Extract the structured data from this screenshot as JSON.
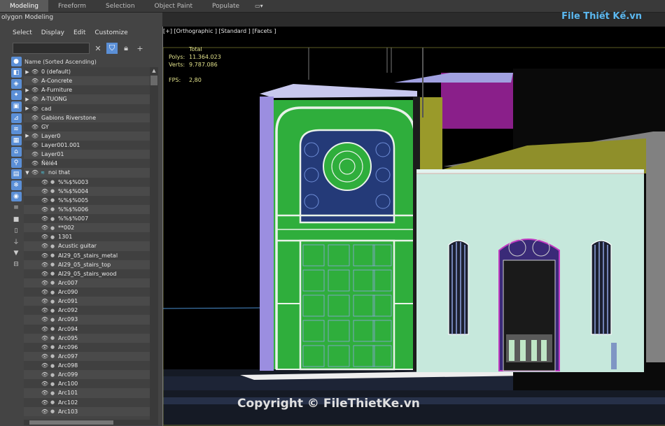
{
  "ribbon": {
    "tabs": [
      "Modeling",
      "Freeform",
      "Selection",
      "Object Paint",
      "Populate"
    ],
    "active": "Modeling",
    "subtab": "olygon Modeling"
  },
  "explorer": {
    "menu": [
      "Select",
      "Display",
      "Edit",
      "Customize"
    ],
    "search_placeholder": "",
    "column_header": "Name (Sorted Ascending)",
    "rows": [
      {
        "label": "0 (default)",
        "level": 0,
        "expander": true
      },
      {
        "label": "A-Concrete",
        "level": 0,
        "expander": false
      },
      {
        "label": "A-Furniture",
        "level": 0,
        "expander": true
      },
      {
        "label": "A-TUONG",
        "level": 0,
        "expander": true
      },
      {
        "label": "cad",
        "level": 0,
        "expander": true
      },
      {
        "label": "Gabions Riverstone",
        "level": 0,
        "expander": false
      },
      {
        "label": "GY",
        "level": 0,
        "expander": false
      },
      {
        "label": "Layer0",
        "level": 0,
        "expander": true
      },
      {
        "label": "Layer001.001",
        "level": 0,
        "expander": false
      },
      {
        "label": "Layer01",
        "level": 0,
        "expander": false
      },
      {
        "label": "Ñèlé4",
        "level": 0,
        "expander": false
      },
      {
        "label": "noi that",
        "level": 0,
        "expander": "open"
      },
      {
        "label": "%%$%003",
        "level": 1
      },
      {
        "label": "%%$%004",
        "level": 1
      },
      {
        "label": "%%$%005",
        "level": 1
      },
      {
        "label": "%%$%006",
        "level": 1
      },
      {
        "label": "%%$%007",
        "level": 1
      },
      {
        "label": "**002",
        "level": 1
      },
      {
        "label": "1301",
        "level": 1
      },
      {
        "label": "Acustic guitar",
        "level": 1
      },
      {
        "label": "AI29_05_stairs_metal",
        "level": 1
      },
      {
        "label": "AI29_05_stairs_top",
        "level": 1
      },
      {
        "label": "AI29_05_stairs_wood",
        "level": 1
      },
      {
        "label": "Arc007",
        "level": 1
      },
      {
        "label": "Arc090",
        "level": 1
      },
      {
        "label": "Arc091",
        "level": 1
      },
      {
        "label": "Arc092",
        "level": 1
      },
      {
        "label": "Arc093",
        "level": 1
      },
      {
        "label": "Arc094",
        "level": 1
      },
      {
        "label": "Arc095",
        "level": 1
      },
      {
        "label": "Arc096",
        "level": 1
      },
      {
        "label": "Arc097",
        "level": 1
      },
      {
        "label": "Arc098",
        "level": 1
      },
      {
        "label": "Arc099",
        "level": 1
      },
      {
        "label": "Arc100",
        "level": 1
      },
      {
        "label": "Arc101",
        "level": 1
      },
      {
        "label": "Arc102",
        "level": 1
      },
      {
        "label": "Arc103",
        "level": 1
      }
    ]
  },
  "viewport": {
    "label": "[+] [Orthographic ] [Standard ] [Facets ]",
    "stats": {
      "total_label": "Total",
      "polys_label": "Polys:",
      "polys_value": "11.364.023",
      "verts_label": "Verts:",
      "verts_value": "9.787.086",
      "fps_label": "FPS:",
      "fps_value": "2,80"
    }
  },
  "branding": {
    "logo": "File Thiết Kế.vn",
    "watermark": "Copyright © FileThietKe.vn"
  },
  "colors": {
    "accent": "#5b8fd6",
    "facade_green": "#2fae3c",
    "wall_mint": "#c6e8dc",
    "roof_purple": "#8a1f8a",
    "roof_olive": "#8f8f2a"
  }
}
